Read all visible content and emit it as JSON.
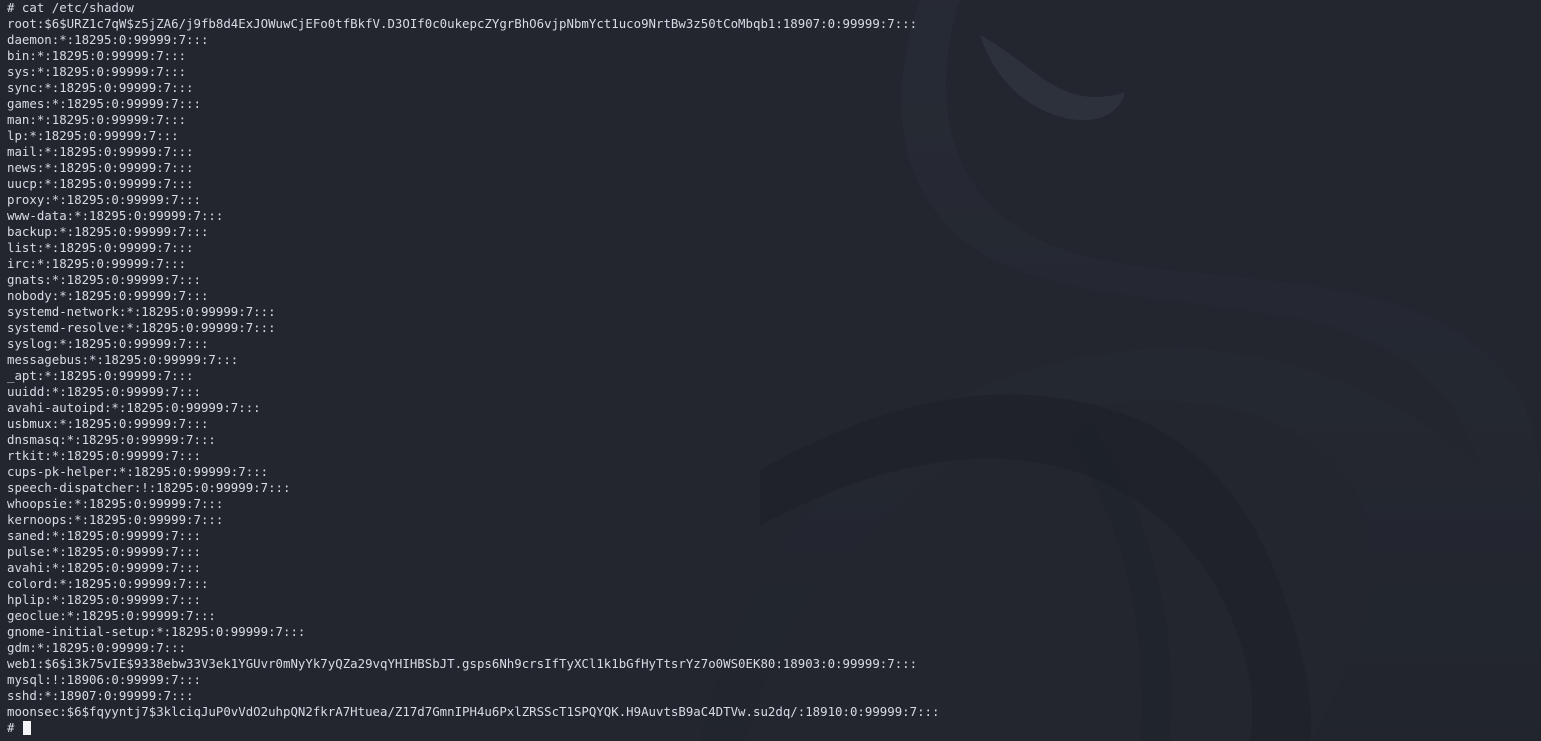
{
  "terminal": {
    "command_line": "# cat /etc/shadow",
    "prompt": "# ",
    "lines": [
      "root:$6$URZ1c7qW$z5jZA6/j9fb8d4ExJOWuwCjEFo0tfBkfV.D3OIf0c0ukepcZYgrBhO6vjpNbmYct1uco9NrtBw3z50tCoMbqb1:18907:0:99999:7:::",
      "daemon:*:18295:0:99999:7:::",
      "bin:*:18295:0:99999:7:::",
      "sys:*:18295:0:99999:7:::",
      "sync:*:18295:0:99999:7:::",
      "games:*:18295:0:99999:7:::",
      "man:*:18295:0:99999:7:::",
      "lp:*:18295:0:99999:7:::",
      "mail:*:18295:0:99999:7:::",
      "news:*:18295:0:99999:7:::",
      "uucp:*:18295:0:99999:7:::",
      "proxy:*:18295:0:99999:7:::",
      "www-data:*:18295:0:99999:7:::",
      "backup:*:18295:0:99999:7:::",
      "list:*:18295:0:99999:7:::",
      "irc:*:18295:0:99999:7:::",
      "gnats:*:18295:0:99999:7:::",
      "nobody:*:18295:0:99999:7:::",
      "systemd-network:*:18295:0:99999:7:::",
      "systemd-resolve:*:18295:0:99999:7:::",
      "syslog:*:18295:0:99999:7:::",
      "messagebus:*:18295:0:99999:7:::",
      "_apt:*:18295:0:99999:7:::",
      "uuidd:*:18295:0:99999:7:::",
      "avahi-autoipd:*:18295:0:99999:7:::",
      "usbmux:*:18295:0:99999:7:::",
      "dnsmasq:*:18295:0:99999:7:::",
      "rtkit:*:18295:0:99999:7:::",
      "cups-pk-helper:*:18295:0:99999:7:::",
      "speech-dispatcher:!:18295:0:99999:7:::",
      "whoopsie:*:18295:0:99999:7:::",
      "kernoops:*:18295:0:99999:7:::",
      "saned:*:18295:0:99999:7:::",
      "pulse:*:18295:0:99999:7:::",
      "avahi:*:18295:0:99999:7:::",
      "colord:*:18295:0:99999:7:::",
      "hplip:*:18295:0:99999:7:::",
      "geoclue:*:18295:0:99999:7:::",
      "gnome-initial-setup:*:18295:0:99999:7:::",
      "gdm:*:18295:0:99999:7:::",
      "web1:$6$i3k75vIE$9338ebw33V3ek1YGUvr0mNyYk7yQZa29vqYHIHBSbJT.gsps6Nh9crsIfTyXCl1k1bGfHyTtsrYz7o0WS0EK80:18903:0:99999:7:::",
      "mysql:!:18906:0:99999:7:::",
      "sshd:*:18907:0:99999:7:::",
      "moonsec:$6$fqyyntj7$3klciqJuP0vVdO2uhpQN2fkrA7Htuea/Z17d7GmnIPH4u6PxlZRSScT1SPQYQK.H9AuvtsB9aC4DTVw.su2dq/:18910:0:99999:7:::"
    ]
  },
  "colors": {
    "background": "#23262f",
    "text": "#d7dbe3",
    "cursor": "#f3f5f8",
    "wallpaper_dragon": "#2d323d"
  },
  "icons": {
    "background_logo": "kali-dragon-icon"
  }
}
